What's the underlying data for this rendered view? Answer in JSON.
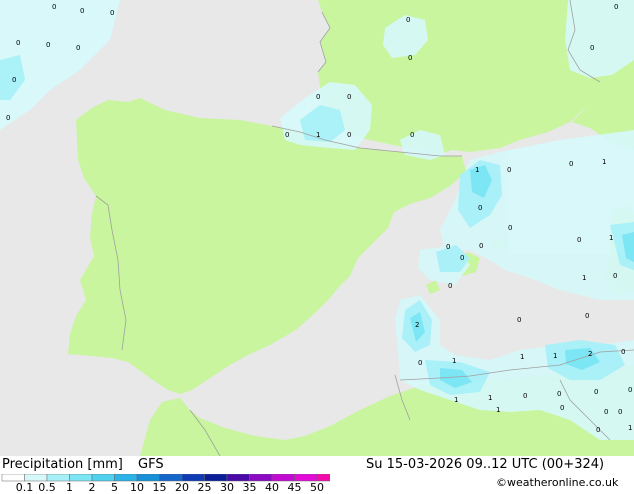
{
  "title": "Precipitation [mm]",
  "model": "GFS",
  "valid_time": "Su 15-03-2026 09..12 UTC (00+324)",
  "credit": "©weatheronline.co.uk",
  "legend": {
    "values": [
      "0.1",
      "0.5",
      "1",
      "2",
      "5",
      "10",
      "15",
      "20",
      "25",
      "30",
      "35",
      "40",
      "45",
      "50"
    ],
    "colors": [
      "#fefefe",
      "#d6f8fa",
      "#a8f0f8",
      "#7ce6f4",
      "#50d2ee",
      "#2cb4e8",
      "#1890d8",
      "#1466c8",
      "#0e3cb4",
      "#0a1e9a",
      "#4a0aa8",
      "#8c0ac2",
      "#c20ad2",
      "#e40ad8",
      "#f40aa8"
    ]
  },
  "colors": {
    "sea": "#e8e8e8",
    "land": "#c8f59e",
    "light_precip": "#d6f8fa",
    "medium_precip": "#a8f0f8",
    "heavy_precip": "#7ce6f4",
    "border": "#a0a0a0"
  },
  "point_labels": [
    "0",
    "0",
    "0",
    "0",
    "0",
    "0",
    "0",
    "0",
    "0",
    "0",
    "0",
    "0",
    "0",
    "0",
    "1",
    "0",
    "0",
    "0",
    "1",
    "0",
    "0",
    "1",
    "0",
    "0",
    "0",
    "0",
    "1",
    "0",
    "1",
    "0",
    "0",
    "2",
    "0",
    "1",
    "1",
    "1",
    "2",
    "0",
    "0",
    "1",
    "1",
    "0",
    "0",
    "0",
    "0",
    "1",
    "1",
    "0",
    "0",
    "0",
    "0",
    "0",
    "0"
  ]
}
